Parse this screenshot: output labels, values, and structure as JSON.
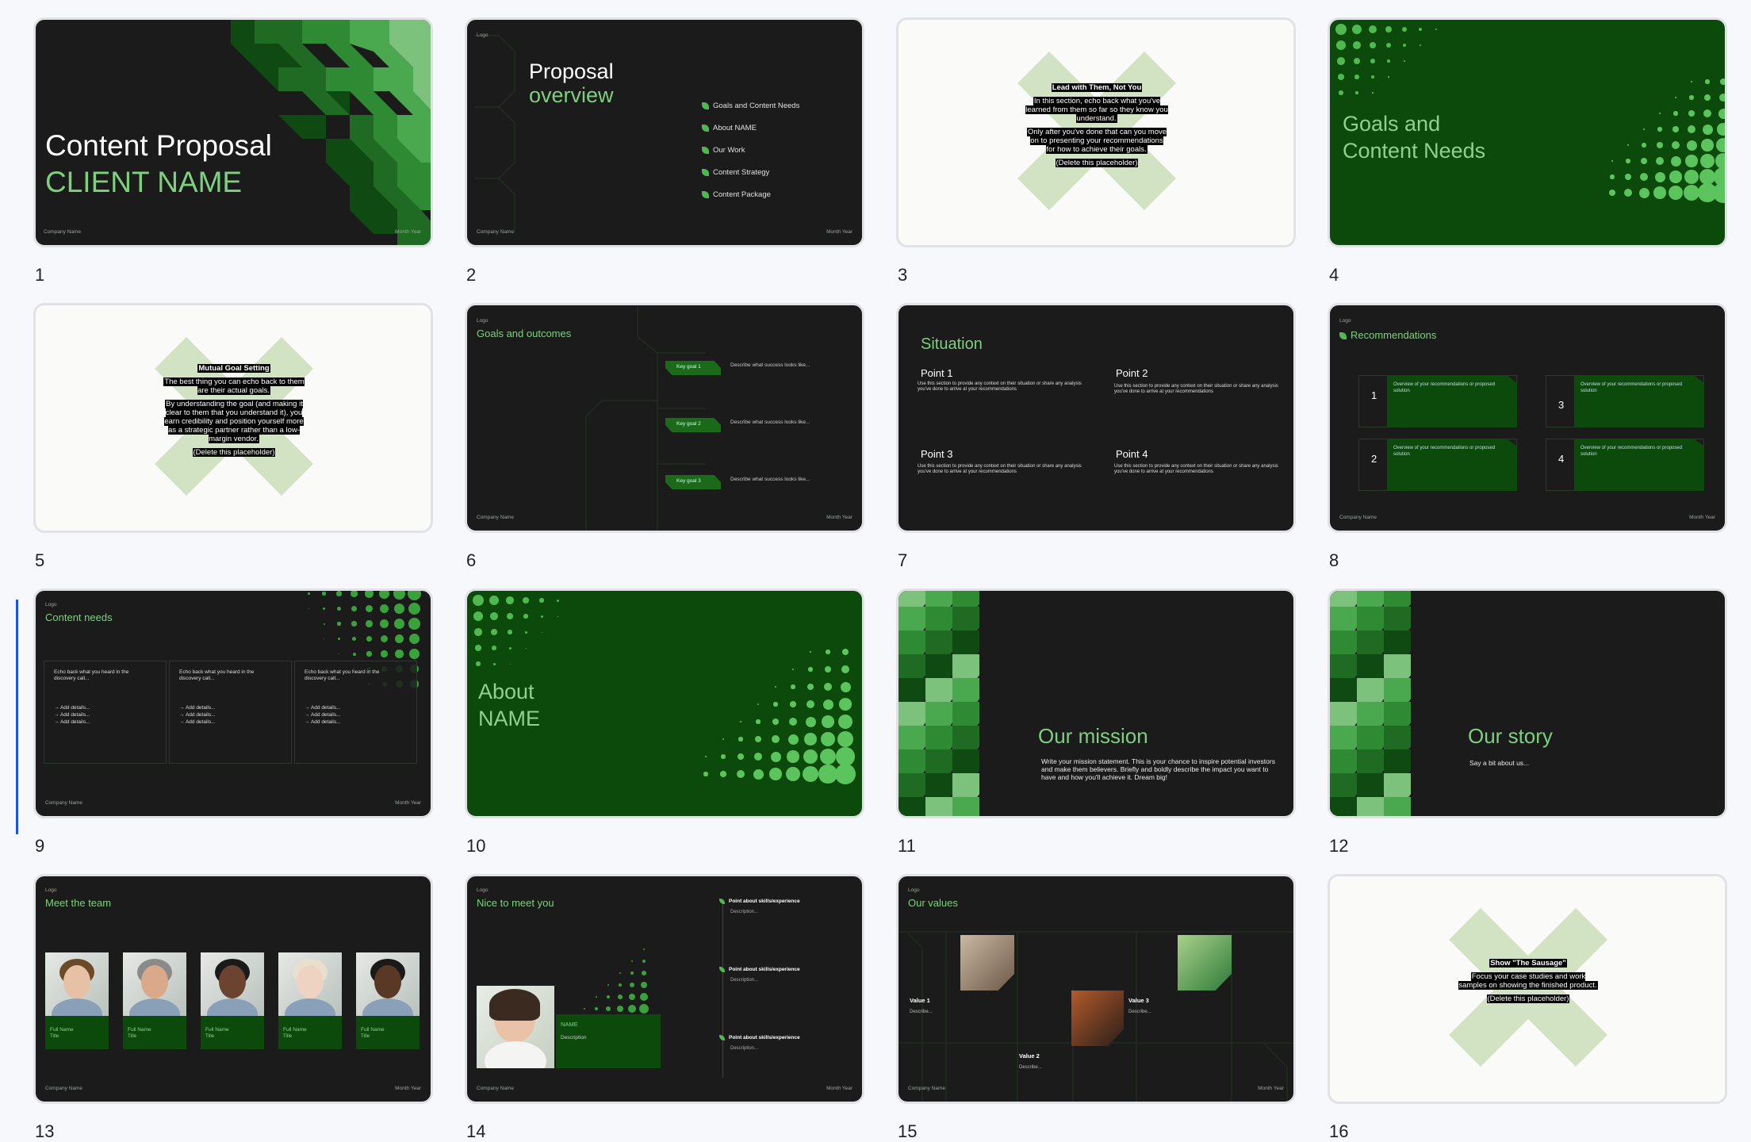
{
  "slides": [
    {
      "num": "1",
      "company": "Company Name",
      "date": "Month Year",
      "title": "Content Proposal",
      "subtitle": "CLIENT NAME"
    },
    {
      "num": "2",
      "logo": "Logo",
      "company": "Company Name",
      "date": "Month Year",
      "title": "Proposal",
      "subtitle": "overview",
      "items": [
        "Goals and Content Needs",
        "About NAME",
        "Our Work",
        "Content Strategy",
        "Content Package"
      ]
    },
    {
      "num": "3",
      "heading": "Lead with Them, Not You",
      "p1": "In this section, echo back what you've learned from them so far so they know you understand.",
      "p2": "Only after you've done that can you move on to presenting your recommendations for how to achieve their goals.",
      "del": "(Delete this placeholder)"
    },
    {
      "num": "4",
      "title1": "Goals and",
      "title2": "Content Needs"
    },
    {
      "num": "5",
      "heading": "Mutual Goal Setting",
      "p1": "The best thing you can echo back to them are their actual goals.",
      "p2": "By understanding the goal (and making it clear to them that you understand it), you earn credibility and position yourself more as a strategic partner rather than a low-margin vendor.",
      "del": "(Delete this placeholder)"
    },
    {
      "num": "6",
      "logo": "Logo",
      "company": "Company Name",
      "date": "Month Year",
      "title": "Goals and outcomes",
      "goals": [
        {
          "label": "Key goal 1",
          "desc": "Describe what success looks like..."
        },
        {
          "label": "Key goal 2",
          "desc": "Describe what success looks like..."
        },
        {
          "label": "Key goal 3",
          "desc": "Describe what success looks like..."
        }
      ]
    },
    {
      "num": "7",
      "title": "Situation",
      "points": [
        {
          "title": "Point 1",
          "desc": "Use this section to provide any context on their situation or share any analysis you've done to arrive at your recommendations"
        },
        {
          "title": "Point 2",
          "desc": "Use this section to provide any context on their situation or share any analysis you've done to arrive at your recommendations"
        },
        {
          "title": "Point 3",
          "desc": "Use this section to provide any context on their situation or share any analysis you've done to arrive at your recommendations"
        },
        {
          "title": "Point 4",
          "desc": "Use this section to provide any context on their situation or share any analysis you've done to arrive at your recommendations"
        }
      ]
    },
    {
      "num": "8",
      "logo": "Logo",
      "company": "Company Name",
      "date": "Month Year",
      "title": "Recommendations",
      "recs": [
        {
          "n": "1",
          "text": "Overview of your recommendations or proposed solution"
        },
        {
          "n": "3",
          "text": "Overview of your recommendations or proposed solution"
        },
        {
          "n": "2",
          "text": "Overview of your recommendations or proposed solution"
        },
        {
          "n": "4",
          "text": "Overview of your recommendations or proposed solution"
        }
      ]
    },
    {
      "num": "9",
      "logo": "Logo",
      "company": "Company Name",
      "date": "Month Year",
      "title": "Content needs",
      "col_text": "Echo back what you heard in the discovery call...",
      "detail": "→ Add details..."
    },
    {
      "num": "10",
      "title1": "About",
      "title2": "NAME"
    },
    {
      "num": "11",
      "title": "Our mission",
      "text": "Write your mission statement. This is your chance to inspire potential investors and make them believers. Briefly and boldly describe the impact you want to have and how you'll achieve it. Dream big!"
    },
    {
      "num": "12",
      "title": "Our story",
      "text": "Say a bit about us..."
    },
    {
      "num": "13",
      "logo": "Logo",
      "company": "Company Name",
      "date": "Month Year",
      "title": "Meet the team",
      "member_name": "Full Name",
      "member_title": "Title"
    },
    {
      "num": "14",
      "logo": "Logo",
      "company": "Company Name",
      "date": "Month Year",
      "title": "Nice to meet you",
      "name": "NAME",
      "desc": "Description",
      "point": "Point about skills/experience",
      "point_desc": "Description..."
    },
    {
      "num": "15",
      "logo": "Logo",
      "company": "Company Name",
      "date": "Month Year",
      "title": "Our values",
      "values": [
        {
          "t": "Value 1",
          "d": "Describe..."
        },
        {
          "t": "Value 2",
          "d": "Describe..."
        },
        {
          "t": "Value 3",
          "d": "Describe..."
        }
      ]
    },
    {
      "num": "16",
      "heading": "Show \"The Sausage\"",
      "p1": "Focus your case studies and work samples on showing the finished product.",
      "del": "(Delete this placeholder)"
    }
  ]
}
